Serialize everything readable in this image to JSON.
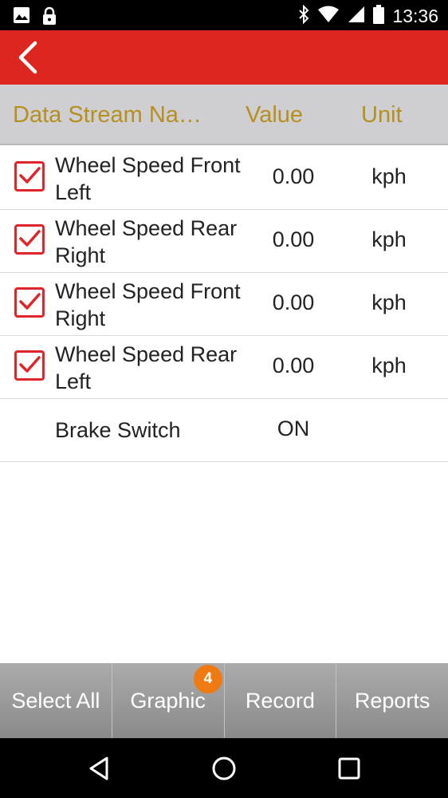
{
  "status_bar": {
    "time": "13:36",
    "left_icons": [
      "image-icon",
      "lock-icon"
    ],
    "right_icons": [
      "bluetooth-icon",
      "wifi-icon",
      "signal-icon",
      "battery-icon"
    ]
  },
  "app_bar": {
    "back_icon": "chevron-left-icon",
    "color": "#dd2620"
  },
  "table": {
    "headers": {
      "name": "Data Stream Na…",
      "value": "Value",
      "unit": "Unit"
    },
    "rows": [
      {
        "name": "Wheel Speed Front Left",
        "value": "0.00",
        "unit": "kph",
        "checked": true
      },
      {
        "name": "Wheel Speed Rear Right",
        "value": "0.00",
        "unit": "kph",
        "checked": true
      },
      {
        "name": "Wheel Speed Front Right",
        "value": "0.00",
        "unit": "kph",
        "checked": true
      },
      {
        "name": "Wheel Speed Rear Left",
        "value": "0.00",
        "unit": "kph",
        "checked": true
      },
      {
        "name": "Brake Switch",
        "value": "ON",
        "unit": "",
        "checked": false
      }
    ]
  },
  "toolbar": {
    "select_all": "Select All",
    "graphic": "Graphic",
    "graphic_badge": "4",
    "record": "Record",
    "reports": "Reports"
  },
  "nav_bar": {
    "icons": [
      "back-triangle-icon",
      "home-circle-icon",
      "recents-square-icon"
    ]
  },
  "colors": {
    "accent": "#dd2620",
    "header_text": "#b5901f",
    "badge": "#f07a12"
  }
}
